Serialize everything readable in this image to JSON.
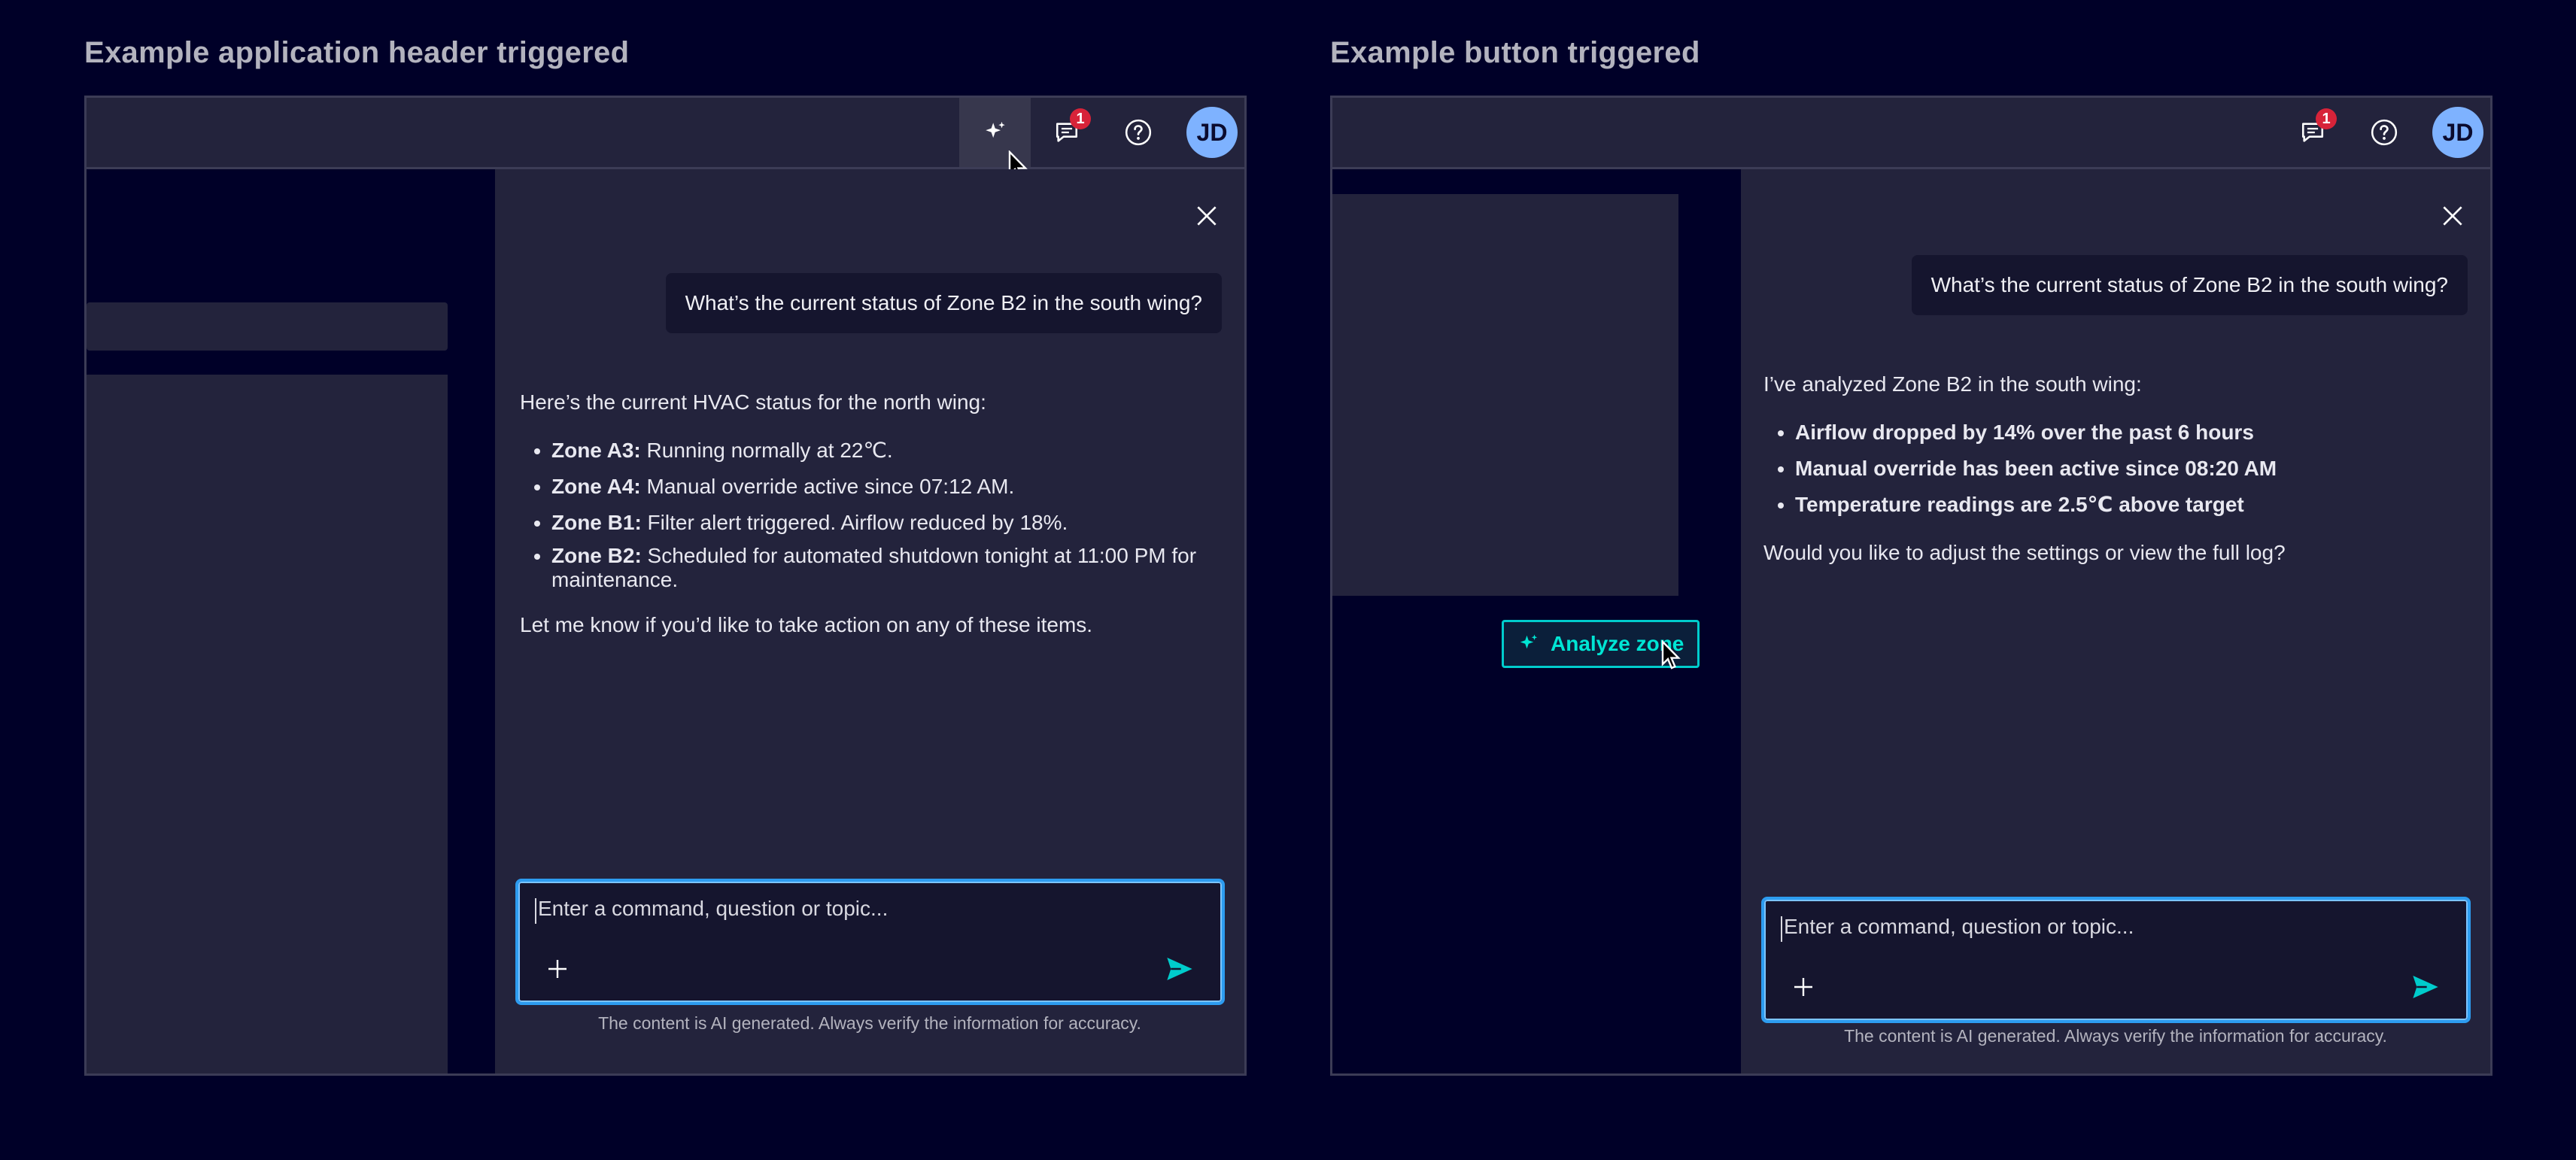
{
  "left": {
    "title": "Example application header triggered",
    "notification_count": "1",
    "avatar_initials": "JD",
    "user_message": "What’s the current status of Zone B2 in the south wing?",
    "ai_intro": "Here’s the current HVAC status for the north wing:",
    "ai_items": [
      {
        "label": "Zone A3:",
        "text": " Running normally at 22℃."
      },
      {
        "label": "Zone A4:",
        "text": " Manual override active since 07:12 AM."
      },
      {
        "label": "Zone B1:",
        "text": " Filter alert triggered. Airflow reduced by 18%."
      },
      {
        "label": "Zone B2:",
        "text": " Scheduled for automated shutdown tonight at 11:00 PM for maintenance."
      }
    ],
    "ai_outro": "Let me know if you’d like to take action on any of these items.",
    "composer_placeholder": "Enter a command, question or topic...",
    "disclaimer": "The content is AI generated. Always verify the information for accuracy."
  },
  "right": {
    "title": "Example button triggered",
    "notification_count": "1",
    "avatar_initials": "JD",
    "analyze_button_label": "Analyze zone",
    "user_message": "What’s the current status of Zone B2 in the south wing?",
    "ai_intro": "I’ve analyzed Zone B2 in the south wing:",
    "ai_items": [
      "Airflow dropped by 14% over the past 6 hours",
      "Manual override has been active since 08:20 AM",
      "Temperature readings are 2.5℃ above target"
    ],
    "ai_outro": "Would you like to adjust the settings or view the full log?",
    "composer_placeholder": "Enter a command, question or topic...",
    "disclaimer": "The content is AI generated. Always verify the information for accuracy."
  },
  "colors": {
    "background": "#000028",
    "surface": "#23233c",
    "accent": "#00cccc",
    "focus": "#2d9cf0",
    "badge": "#d72339",
    "avatar": "#7eb2ff"
  },
  "icons": [
    "ai-sparkle-icon",
    "chat-icon",
    "help-icon",
    "close-icon",
    "plus-icon",
    "send-icon",
    "cursor-icon"
  ]
}
